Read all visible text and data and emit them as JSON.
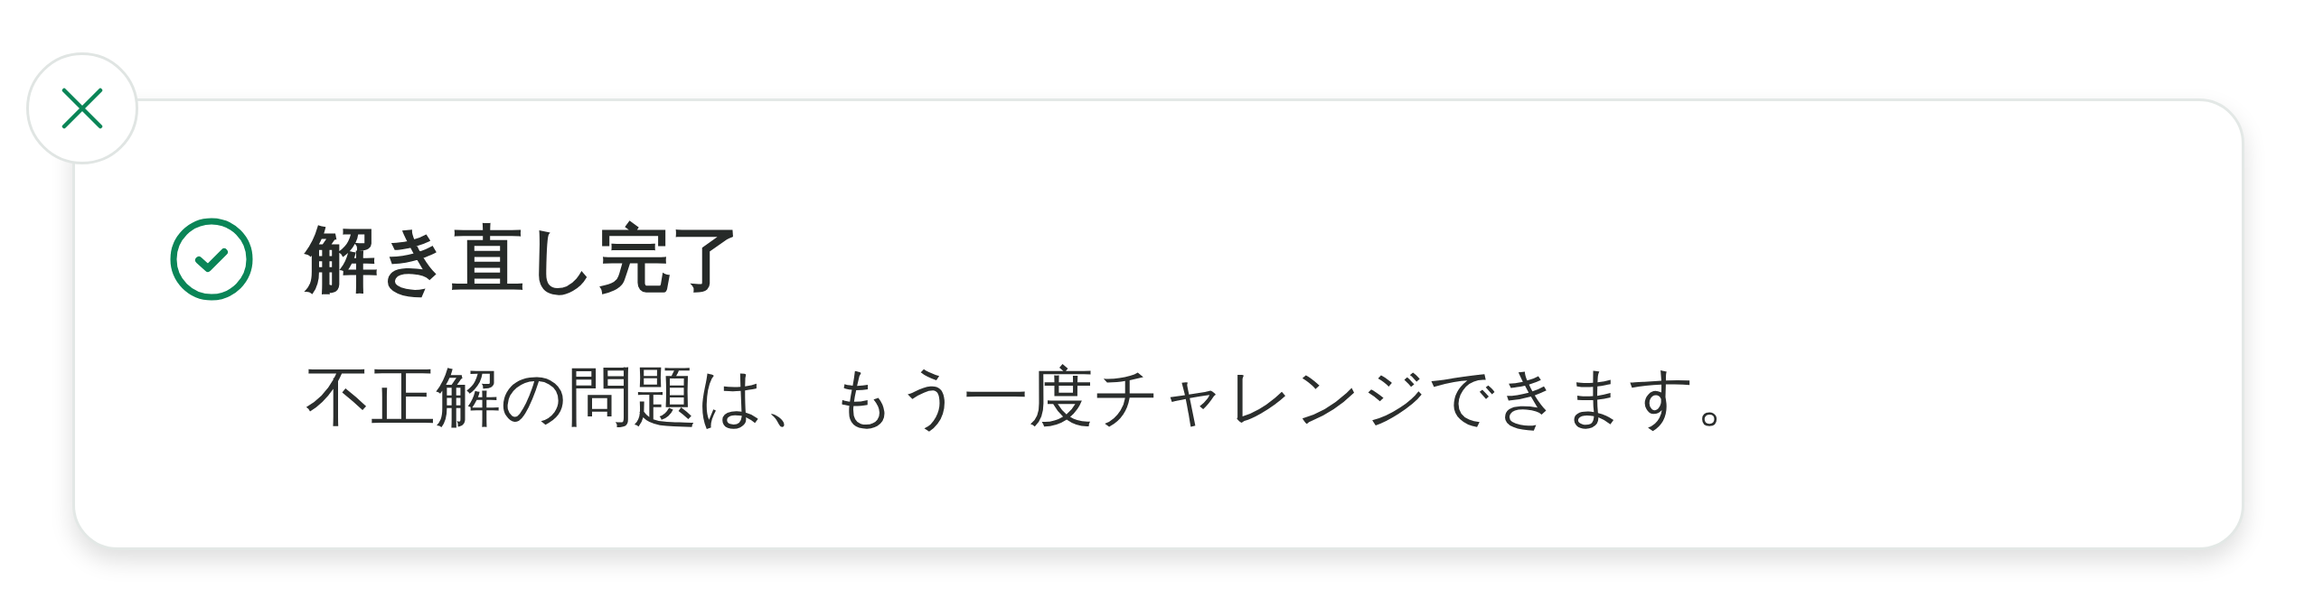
{
  "toast": {
    "kind": "success",
    "title": "解き直し完了",
    "message": "不正解の問題は、もう一度チャレンジできます。"
  }
}
